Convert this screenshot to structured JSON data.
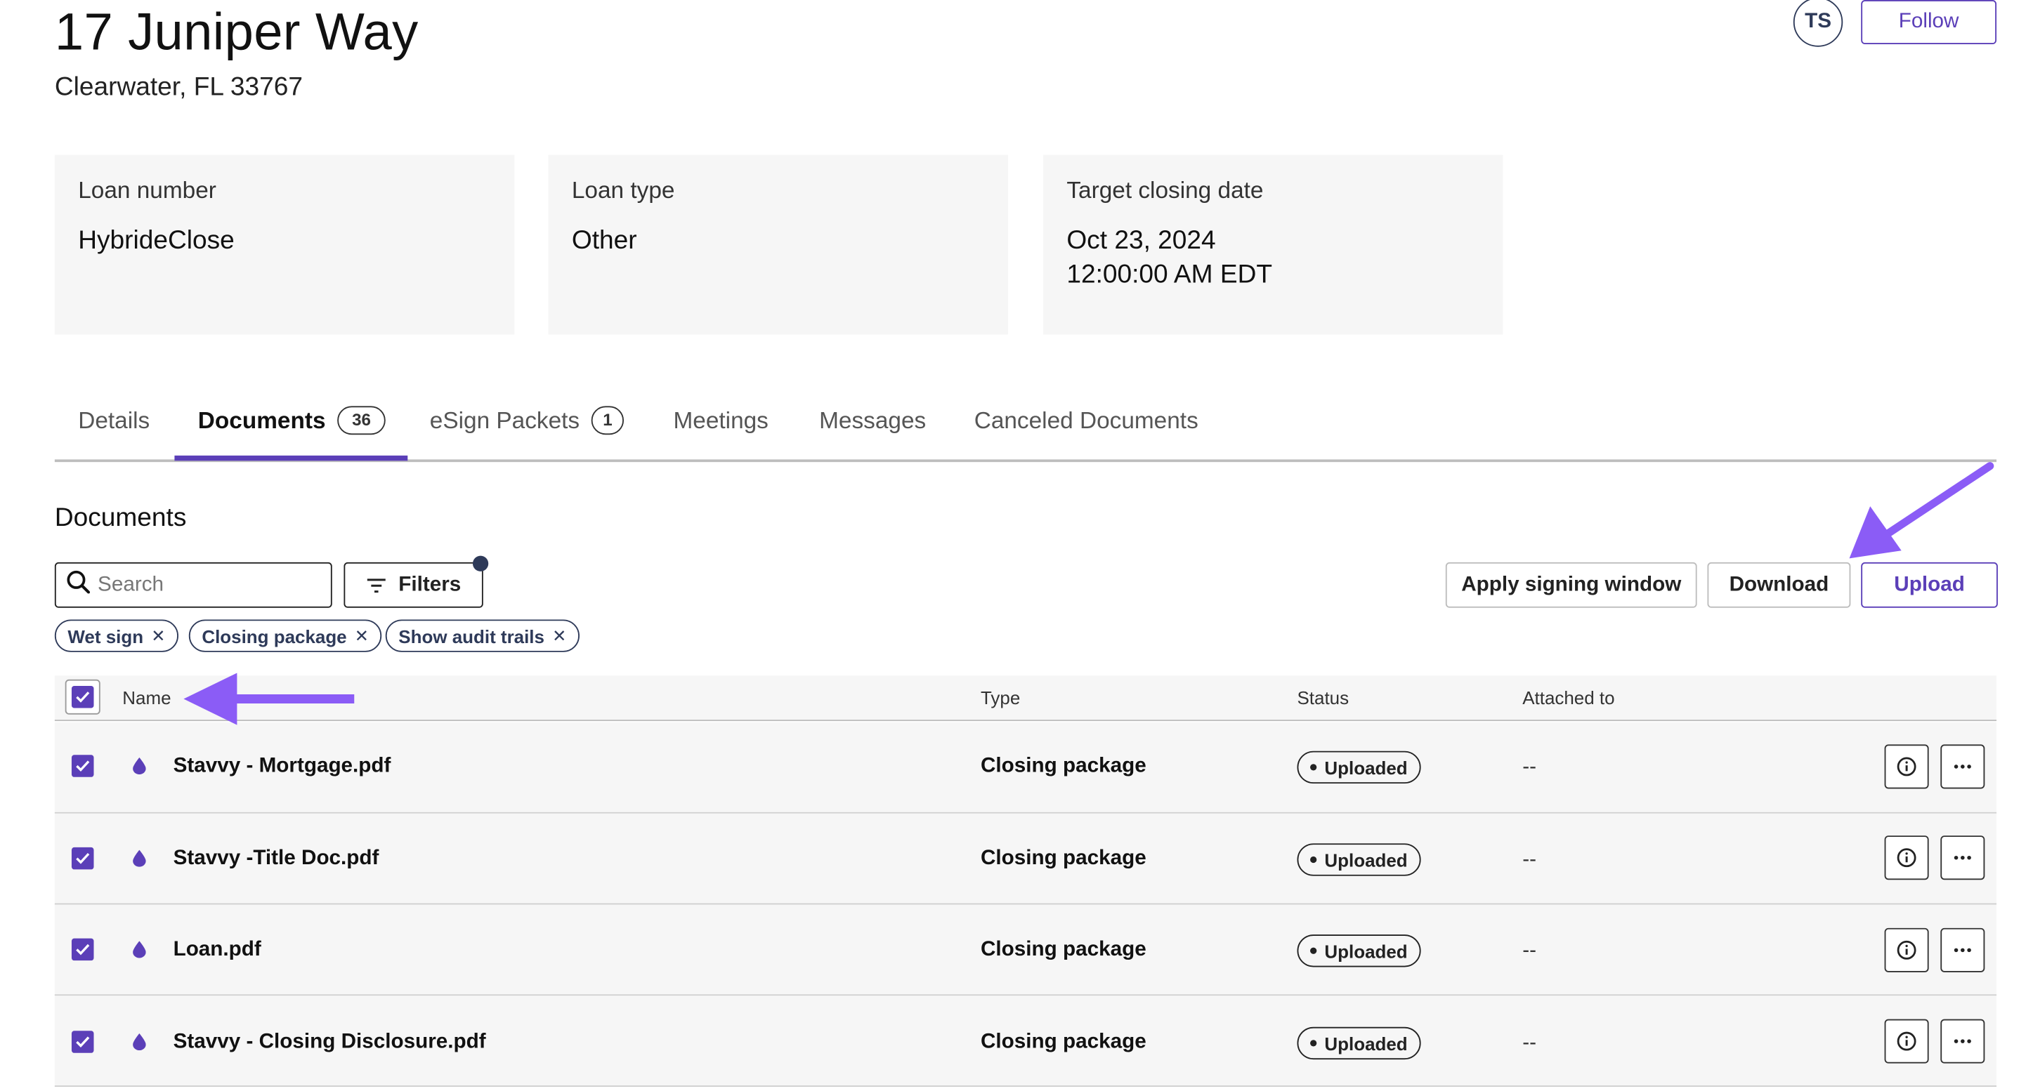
{
  "header": {
    "title": "17 Juniper Way",
    "subtitle": "Clearwater, FL 33767",
    "avatar_initials": "TS",
    "follow_label": "Follow"
  },
  "cards": [
    {
      "label": "Loan number",
      "value": "HybrideClose",
      "value2": ""
    },
    {
      "label": "Loan type",
      "value": "Other",
      "value2": ""
    },
    {
      "label": "Target closing date",
      "value": "Oct 23, 2024",
      "value2": "12:00:00 AM EDT"
    }
  ],
  "tabs": [
    {
      "label": "Details",
      "count": ""
    },
    {
      "label": "Documents",
      "count": "36"
    },
    {
      "label": "eSign Packets",
      "count": "1"
    },
    {
      "label": "Meetings",
      "count": ""
    },
    {
      "label": "Messages",
      "count": ""
    },
    {
      "label": "Canceled Documents",
      "count": ""
    }
  ],
  "documents": {
    "section_title": "Documents",
    "search_placeholder": "Search",
    "filters_label": "Filters",
    "apply_label": "Apply signing window",
    "download_label": "Download",
    "upload_label": "Upload",
    "chips": [
      "Wet sign",
      "Closing package",
      "Show audit trails"
    ],
    "columns": [
      "Name",
      "Type",
      "Status",
      "Attached to"
    ],
    "rows": [
      {
        "name": "Stavvy - Mortgage.pdf",
        "type": "Closing package",
        "status": "Uploaded",
        "attached": "--"
      },
      {
        "name": "Stavvy -Title Doc.pdf",
        "type": "Closing package",
        "status": "Uploaded",
        "attached": "--"
      },
      {
        "name": "Loan.pdf",
        "type": "Closing package",
        "status": "Uploaded",
        "attached": "--"
      },
      {
        "name": "Stavvy - Closing Disclosure.pdf",
        "type": "Closing package",
        "status": "Uploaded",
        "attached": "--"
      }
    ]
  },
  "colors": {
    "accent": "#5b3fb8",
    "arrow": "#8b5cf6",
    "card_bg": "#f6f6f6",
    "dark": "#2e3a59"
  }
}
